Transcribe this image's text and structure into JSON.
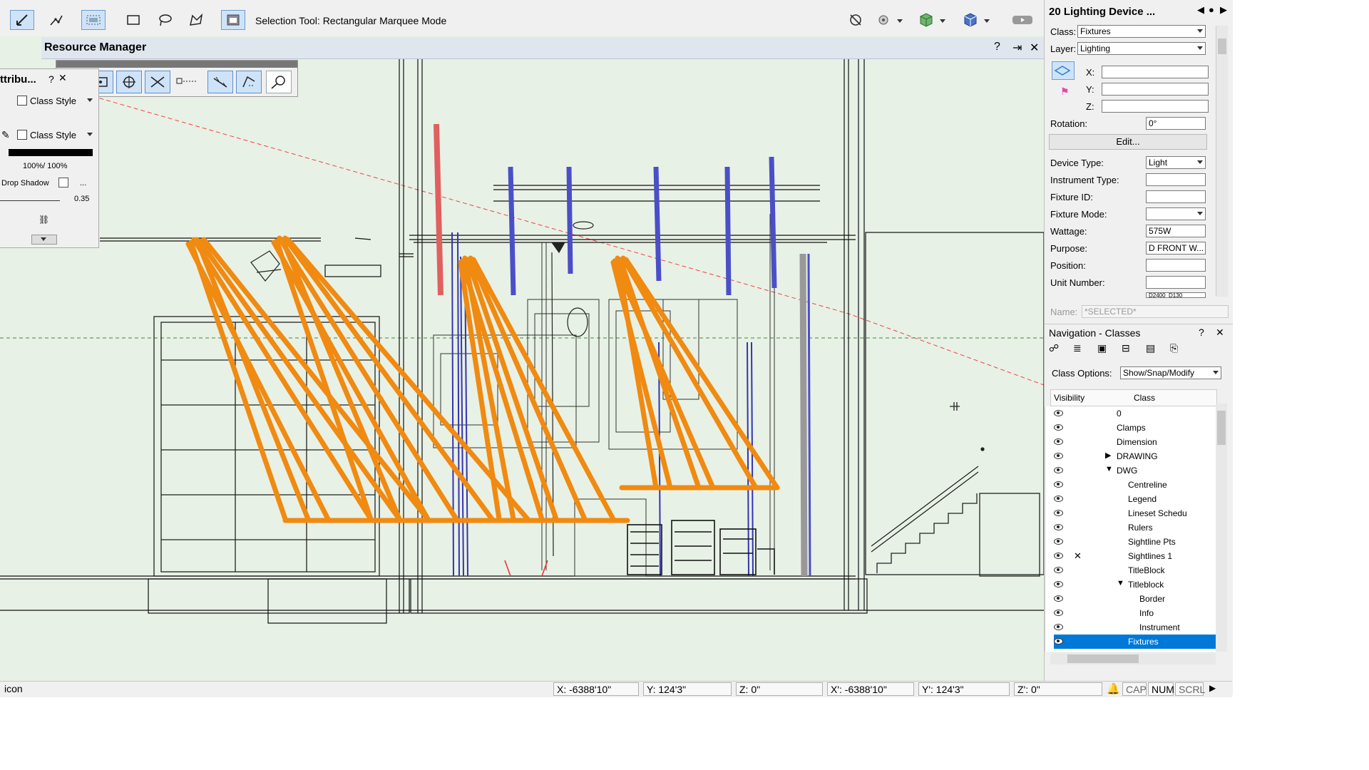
{
  "toolbar": {
    "tool_status": "Selection Tool: Rectangular Marquee Mode"
  },
  "resource_manager": {
    "title": "Resource Manager",
    "help": "?",
    "pin": "⇥",
    "close": "✕"
  },
  "attributes": {
    "title": "ttribu...",
    "help": "?",
    "fill_style": "Class Style",
    "pen_style": "Class Style",
    "opacity": "100%/ 100%",
    "drop_shadow": "Drop Shadow",
    "ellipsis": "...",
    "line_weight": "0.35"
  },
  "object_info": {
    "title": "20 Lighting Device ...",
    "class_label": "Class:",
    "class_value": "Fixtures",
    "layer_label": "Layer:",
    "layer_value": "Lighting",
    "x_label": "X:",
    "y_label": "Y:",
    "z_label": "Z:",
    "rotation_label": "Rotation:",
    "rotation_value": "0°",
    "edit_button": "Edit...",
    "device_type_label": "Device Type:",
    "device_type_value": "Light",
    "instrument_type_label": "Instrument Type:",
    "fixture_id_label": "Fixture ID:",
    "fixture_mode_label": "Fixture Mode:",
    "wattage_label": "Wattage:",
    "wattage_value": "575W",
    "purpose_label": "Purpose:",
    "purpose_value": "D FRONT W...",
    "position_label": "Position:",
    "unit_number_label": "Unit Number:",
    "partial_value": "D2400_D130",
    "name_label": "Name:",
    "name_placeholder": "*SELECTED*"
  },
  "navigation": {
    "title": "Navigation - Classes",
    "help": "?",
    "close": "✕",
    "class_options_label": "Class Options:",
    "class_options_value": "Show/Snap/Modify",
    "col_visibility": "Visibility",
    "col_class": "Class",
    "classes": [
      {
        "name": "0",
        "indent": 0,
        "expander": "",
        "selected": false,
        "extra": ""
      },
      {
        "name": "Clamps",
        "indent": 0,
        "expander": "",
        "selected": false,
        "extra": ""
      },
      {
        "name": "Dimension",
        "indent": 0,
        "expander": "",
        "selected": false,
        "extra": ""
      },
      {
        "name": "DRAWING",
        "indent": 0,
        "expander": "closed",
        "selected": false,
        "extra": ""
      },
      {
        "name": "DWG",
        "indent": 0,
        "expander": "open",
        "selected": false,
        "extra": ""
      },
      {
        "name": "Centreline",
        "indent": 1,
        "expander": "",
        "selected": false,
        "extra": ""
      },
      {
        "name": "Legend",
        "indent": 1,
        "expander": "",
        "selected": false,
        "extra": ""
      },
      {
        "name": "Lineset Schedu",
        "indent": 1,
        "expander": "",
        "selected": false,
        "extra": ""
      },
      {
        "name": "Rulers",
        "indent": 1,
        "expander": "",
        "selected": false,
        "extra": ""
      },
      {
        "name": "Sightline Pts",
        "indent": 1,
        "expander": "",
        "selected": false,
        "extra": ""
      },
      {
        "name": "Sightlines 1",
        "indent": 1,
        "expander": "",
        "selected": false,
        "extra": "✕"
      },
      {
        "name": "TitleBlock",
        "indent": 1,
        "expander": "",
        "selected": false,
        "extra": ""
      },
      {
        "name": "Titleblock",
        "indent": 1,
        "expander": "open",
        "selected": false,
        "extra": ""
      },
      {
        "name": "Border",
        "indent": 2,
        "expander": "",
        "selected": false,
        "extra": ""
      },
      {
        "name": "Info",
        "indent": 2,
        "expander": "",
        "selected": false,
        "extra": ""
      },
      {
        "name": "Instrument",
        "indent": 2,
        "expander": "",
        "selected": false,
        "extra": ""
      },
      {
        "name": "Fixtures",
        "indent": 0,
        "expander": "",
        "selected": true,
        "extra": ""
      }
    ]
  },
  "status_bar": {
    "message": "icon",
    "x": "X: -6388'10\"",
    "y": "Y: 124'3\"",
    "z": "Z: 0\"",
    "x2": "X': -6388'10\"",
    "y2": "Y': 124'3\"",
    "z2": "Z': 0\"",
    "cap": "CAP",
    "num": "NUM",
    "scrl": "SCRL"
  },
  "colors": {
    "canvas_bg": "#e8f1e6",
    "beam": "#f08a10",
    "pipe_blue": "#4a4fc8",
    "pipe_red": "#e06060",
    "selection": "#0078d7"
  }
}
